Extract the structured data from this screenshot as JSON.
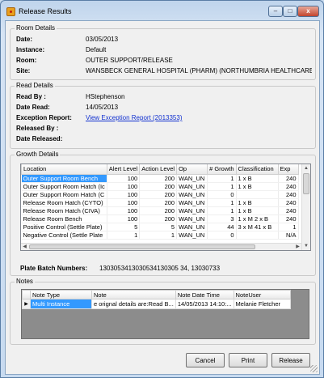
{
  "window": {
    "title": "Release Results",
    "icon": "app-icon",
    "controls": {
      "minimize": "–",
      "maximize": "□",
      "close": "x"
    }
  },
  "room_details": {
    "group_title": "Room Details",
    "date_label": "Date:",
    "date_value": "03/05/2013",
    "instance_label": "Instance:",
    "instance_value": "Default",
    "room_label": "Room:",
    "room_value": "OUTER SUPPORT/RELEASE",
    "site_label": "Site:",
    "site_value": "WANSBECK GENERAL HOSPITAL (PHARM) (NORTHUMBRIA HEALTHCARE"
  },
  "read_details": {
    "group_title": "Read Details",
    "read_by_label": "Read By :",
    "read_by_value": "HStephenson",
    "date_read_label": "Date Read:",
    "date_read_value": "14/05/2013",
    "exception_label": "Exception Report:",
    "exception_link": "View Exception Report (2013353)",
    "released_by_label": "Released By :",
    "released_by_value": "",
    "date_released_label": "Date Released:",
    "date_released_value": ""
  },
  "growth_details": {
    "group_title": "Growth Details",
    "columns": [
      "Location",
      "Alert Level",
      "Action Level",
      "Op",
      "# Growth",
      "Classification",
      "Exp"
    ],
    "rows": [
      [
        "Outer Support Room Bench",
        "100",
        "200",
        "WAN_UN",
        "1",
        "1 x B",
        "240"
      ],
      [
        "Outer Support Room Hatch (Ic",
        "100",
        "200",
        "WAN_UN",
        "1",
        "1 x B",
        "240"
      ],
      [
        "Outer Support Room Hatch (C",
        "100",
        "200",
        "WAN_UN",
        "0",
        "",
        "240"
      ],
      [
        "Release Room Hatch (CYTO)",
        "100",
        "200",
        "WAN_UN",
        "1",
        "1 x B",
        "240"
      ],
      [
        "Release Room Hatch (CIVA)",
        "100",
        "200",
        "WAN_UN",
        "1",
        "1 x B",
        "240"
      ],
      [
        "Release Room Bench",
        "100",
        "200",
        "WAN_UN",
        "3",
        "1 x M 2 x B",
        "240"
      ],
      [
        "Positive Control (Settle Plate)",
        "5",
        "5",
        "WAN_UN",
        "44",
        "3 x M 41 x B",
        "1"
      ],
      [
        "Negative Control (Settle Plate",
        "1",
        "1",
        "WAN_UN",
        "0",
        "",
        "N/A"
      ]
    ],
    "plate_batch_label": "Plate Batch Numbers:",
    "plate_batch_value": "1303053413030534130305 34, 13030733"
  },
  "notes": {
    "group_title": "Notes",
    "columns": [
      "Note Type",
      "Note",
      "Note Date Time",
      "NoteUser"
    ],
    "rows": [
      [
        "Multi Instance",
        "e orignal details are:Read B...",
        "14/05/2013 14:10:...",
        "Melanie Fletcher"
      ]
    ]
  },
  "buttons": {
    "cancel": "Cancel",
    "print": "Print",
    "release": "Release"
  },
  "colors": {
    "selection": "#3399ff",
    "link": "#1030d0",
    "window_frame": "#c9dcf0"
  }
}
